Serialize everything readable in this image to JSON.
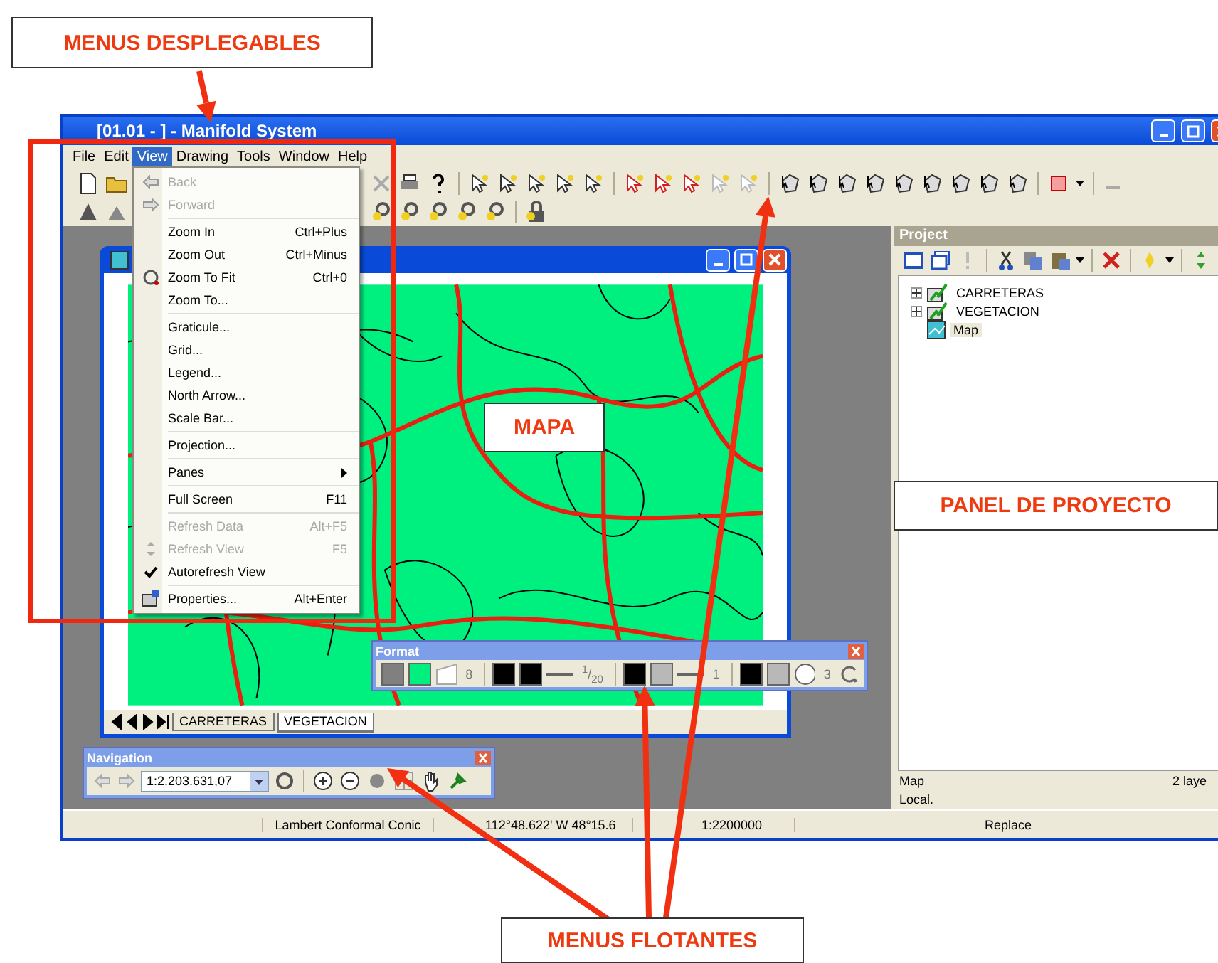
{
  "callouts": [
    {
      "text": "MENUS DESPLEGABLES"
    },
    {
      "text": "MAPA"
    },
    {
      "text": "PANEL DE PROYECTO"
    },
    {
      "text": "MENUS FLOTANTES"
    }
  ],
  "window": {
    "title": "[01.01 - ] - Manifold System"
  },
  "menubar": [
    {
      "label": "File",
      "selected": false
    },
    {
      "label": "Edit",
      "selected": false
    },
    {
      "label": "View",
      "selected": true
    },
    {
      "label": "Drawing",
      "selected": false
    },
    {
      "label": "Tools",
      "selected": false
    },
    {
      "label": "Window",
      "selected": false
    },
    {
      "label": "Help",
      "selected": false
    }
  ],
  "view_menu": {
    "groups": [
      [
        {
          "label": "Back",
          "disabled": true,
          "checked": false,
          "submenu": false
        },
        {
          "label": "Forward",
          "disabled": true,
          "checked": false,
          "submenu": false
        }
      ],
      [
        {
          "label": "Zoom In",
          "shortcut": "Ctrl+Plus",
          "disabled": false,
          "checked": false,
          "submenu": false
        },
        {
          "label": "Zoom Out",
          "shortcut": "Ctrl+Minus",
          "disabled": false,
          "checked": false,
          "submenu": false
        },
        {
          "label": "Zoom To Fit",
          "shortcut": "Ctrl+0",
          "disabled": false,
          "checked": false,
          "submenu": false
        },
        {
          "label": "Zoom To...",
          "disabled": false,
          "checked": false,
          "submenu": false
        }
      ],
      [
        {
          "label": "Graticule...",
          "disabled": false,
          "checked": false,
          "submenu": false
        },
        {
          "label": "Grid...",
          "disabled": false,
          "checked": false,
          "submenu": false
        },
        {
          "label": "Legend...",
          "disabled": false,
          "checked": false,
          "submenu": false
        },
        {
          "label": "North Arrow...",
          "disabled": false,
          "checked": false,
          "submenu": false
        },
        {
          "label": "Scale Bar...",
          "disabled": false,
          "checked": false,
          "submenu": false
        }
      ],
      [
        {
          "label": "Projection...",
          "disabled": false,
          "checked": false,
          "submenu": false
        }
      ],
      [
        {
          "label": "Panes",
          "disabled": false,
          "checked": false,
          "submenu": true
        }
      ],
      [
        {
          "label": "Full Screen",
          "shortcut": "F11",
          "disabled": false,
          "checked": false,
          "submenu": false
        }
      ],
      [
        {
          "label": "Refresh Data",
          "shortcut": "Alt+F5",
          "disabled": true,
          "checked": false,
          "submenu": false
        },
        {
          "label": "Refresh View",
          "shortcut": "F5",
          "disabled": true,
          "checked": false,
          "submenu": false
        },
        {
          "label": "Autorefresh View",
          "disabled": false,
          "checked": true,
          "submenu": false
        }
      ],
      [
        {
          "label": "Properties...",
          "shortcut": "Alt+Enter",
          "disabled": false,
          "checked": false,
          "submenu": false
        }
      ]
    ]
  },
  "map_window": {
    "tabs": [
      {
        "label": "CARRETERAS",
        "selected": false
      },
      {
        "label": "VEGETACION",
        "selected": true
      }
    ]
  },
  "format_toolbar": {
    "title": "Format",
    "items": [
      {
        "kind": "swatch",
        "color": "#808080"
      },
      {
        "kind": "swatch",
        "color": "#00f080"
      },
      {
        "kind": "shape"
      },
      {
        "kind": "text",
        "text": "8"
      },
      {
        "kind": "separator"
      },
      {
        "kind": "swatch",
        "color": "#000000"
      },
      {
        "kind": "swatch",
        "color": "#000000"
      },
      {
        "kind": "line"
      },
      {
        "kind": "text",
        "text": "$^{1}$/$_{20}$"
      },
      {
        "kind": "separator"
      },
      {
        "kind": "swatch",
        "color": "#000000"
      },
      {
        "kind": "swatch",
        "color": "#b8b8b8"
      },
      {
        "kind": "line"
      },
      {
        "kind": "text",
        "text": "1"
      },
      {
        "kind": "separator"
      },
      {
        "kind": "swatch",
        "color": "#000000"
      },
      {
        "kind": "swatch",
        "color": "#b8b8b8"
      },
      {
        "kind": "circle"
      },
      {
        "kind": "text",
        "text": "3"
      },
      {
        "kind": "rotate"
      }
    ]
  },
  "navigation_toolbar": {
    "title": "Navigation",
    "scale": "1:2.203.631,07"
  },
  "project": {
    "title": "Project",
    "tree": [
      {
        "label": "CARRETERAS",
        "kind": "drawing",
        "expanded": false,
        "selected": false
      },
      {
        "label": "VEGETACION",
        "kind": "drawing",
        "expanded": false,
        "selected": false
      },
      {
        "label": "Map",
        "kind": "map",
        "selected": true
      }
    ],
    "info": {
      "name": "Map",
      "location": "Local.",
      "layers": "2 laye"
    }
  },
  "status_bar": [
    "Lambert Conformal Conic",
    "112°48.622' W 48°15.6",
    "1:2200000",
    "Replace"
  ]
}
